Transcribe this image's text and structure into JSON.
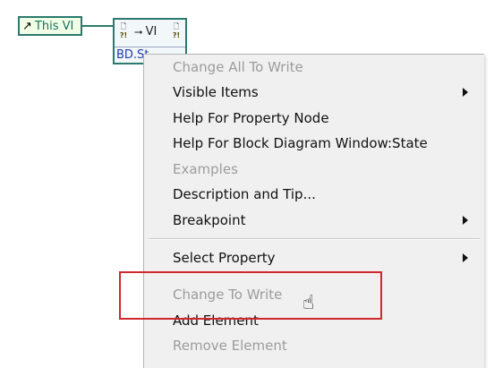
{
  "diagram": {
    "this_vi_label": "This VI",
    "this_vi_icon": "arrow-reference-icon",
    "property_node": {
      "class_label": "VI",
      "class_icon": "plug-icon",
      "property_row": "BD.St"
    },
    "wire_color": "#2a7a6e"
  },
  "context_menu": {
    "items": [
      {
        "label": "Change All To Write",
        "enabled": false,
        "submenu": false
      },
      {
        "label": "Visible Items",
        "enabled": true,
        "submenu": true
      },
      {
        "label": "Help For Property Node",
        "enabled": true,
        "submenu": false
      },
      {
        "label": "Help For Block Diagram Window:State",
        "enabled": true,
        "submenu": false
      },
      {
        "label": "Examples",
        "enabled": false,
        "submenu": false
      },
      {
        "label": "Description and Tip...",
        "enabled": true,
        "submenu": false
      },
      {
        "label": "Breakpoint",
        "enabled": true,
        "submenu": true
      },
      {
        "label": "Select Property",
        "enabled": true,
        "submenu": true
      },
      {
        "label": "Change To Write",
        "enabled": false,
        "submenu": false
      },
      {
        "label": "Add Element",
        "enabled": true,
        "submenu": false
      },
      {
        "label": "Remove Element",
        "enabled": false,
        "submenu": false
      }
    ]
  },
  "annotation": {
    "highlight_color": "#d0282e",
    "cursor_icon": "hand-pointer-icon"
  }
}
